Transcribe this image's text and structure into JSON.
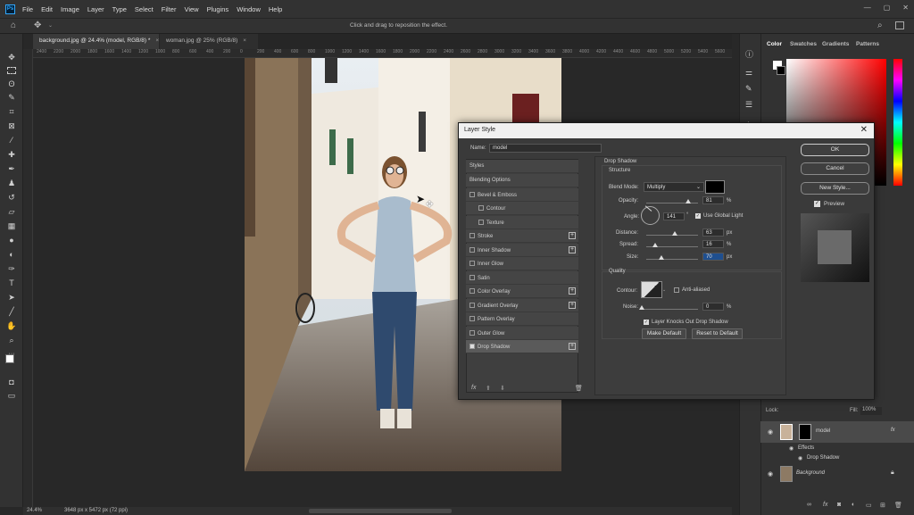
{
  "menubar": {
    "logo": "Ps",
    "items": [
      "File",
      "Edit",
      "Image",
      "Layer",
      "Type",
      "Select",
      "Filter",
      "View",
      "Plugins",
      "Window",
      "Help"
    ]
  },
  "options": {
    "hint": "Click and drag to reposition the effect."
  },
  "tabs": [
    {
      "label": "background.jpg @ 24.4% (model, RGB/8) *",
      "active": true
    },
    {
      "label": "woman.jpg @ 25% (RGB/8)",
      "active": false
    }
  ],
  "ruler": {
    "ticks": [
      "2400",
      "2200",
      "2000",
      "1800",
      "1600",
      "1400",
      "1200",
      "1000",
      "800",
      "600",
      "400",
      "200",
      "0",
      "200",
      "400",
      "600",
      "800",
      "1000",
      "1200",
      "1400",
      "1600",
      "1800",
      "2000",
      "2200",
      "2400",
      "2600",
      "2800",
      "3000",
      "3200",
      "3400",
      "3600",
      "3800",
      "4000",
      "4200",
      "4400",
      "4600",
      "4800",
      "5000",
      "5200",
      "5400",
      "5600"
    ]
  },
  "status": {
    "zoom": "24.4%",
    "size": "3648 px x 5472 px (72 ppi)"
  },
  "color_panel": {
    "tabs": [
      "Color",
      "Swatches",
      "Gradients",
      "Patterns"
    ]
  },
  "dialog": {
    "title": "Layer Style",
    "name_label": "Name:",
    "name_value": "model",
    "styles_header": "Styles",
    "style_items": [
      {
        "label": "Blending Options",
        "checkbox": false,
        "plus": false,
        "indent": false,
        "selected": false
      },
      {
        "label": "Bevel & Emboss",
        "checkbox": true,
        "plus": false,
        "indent": false,
        "selected": false
      },
      {
        "label": "Contour",
        "checkbox": true,
        "plus": false,
        "indent": true,
        "selected": false
      },
      {
        "label": "Texture",
        "checkbox": true,
        "plus": false,
        "indent": true,
        "selected": false
      },
      {
        "label": "Stroke",
        "checkbox": true,
        "plus": true,
        "indent": false,
        "selected": false
      },
      {
        "label": "Inner Shadow",
        "checkbox": true,
        "plus": true,
        "indent": false,
        "selected": false
      },
      {
        "label": "Inner Glow",
        "checkbox": true,
        "plus": false,
        "indent": false,
        "selected": false
      },
      {
        "label": "Satin",
        "checkbox": true,
        "plus": false,
        "indent": false,
        "selected": false
      },
      {
        "label": "Color Overlay",
        "checkbox": true,
        "plus": true,
        "indent": false,
        "selected": false
      },
      {
        "label": "Gradient Overlay",
        "checkbox": true,
        "plus": true,
        "indent": false,
        "selected": false
      },
      {
        "label": "Pattern Overlay",
        "checkbox": true,
        "plus": false,
        "indent": false,
        "selected": false
      },
      {
        "label": "Outer Glow",
        "checkbox": true,
        "plus": false,
        "indent": false,
        "selected": false
      },
      {
        "label": "Drop Shadow",
        "checkbox": true,
        "plus": true,
        "indent": false,
        "selected": true,
        "checked": true
      }
    ],
    "section_title": "Drop Shadow",
    "structure_title": "Structure",
    "blend_mode_label": "Blend Mode:",
    "blend_mode_value": "Multiply",
    "shadow_color": "#000000",
    "opacity_label": "Opacity:",
    "opacity_value": "81",
    "angle_label": "Angle:",
    "angle_value": "141",
    "global_light_label": "Use Global Light",
    "distance_label": "Distance:",
    "distance_value": "63",
    "spread_label": "Spread:",
    "spread_value": "16",
    "size_label": "Size:",
    "size_value": "70",
    "unit_px": "px",
    "unit_pct": "%",
    "deg": "°",
    "quality_title": "Quality",
    "contour_label": "Contour:",
    "anti_aliased_label": "Anti-aliased",
    "noise_label": "Noise:",
    "noise_value": "0",
    "knockout_label": "Layer Knocks Out Drop Shadow",
    "make_default": "Make Default",
    "reset_default": "Reset to Default",
    "ok": "OK",
    "cancel": "Cancel",
    "new_style": "New Style...",
    "preview_label": "Preview",
    "fx_label": "fx"
  },
  "layers": {
    "lock_label": "Lock:",
    "fill_label": "Fill:",
    "fill_value": "100%",
    "items": [
      {
        "name": "model",
        "fx": "fx"
      },
      {
        "name": "Effects"
      },
      {
        "name": "Drop Shadow"
      },
      {
        "name": "Background"
      }
    ]
  }
}
